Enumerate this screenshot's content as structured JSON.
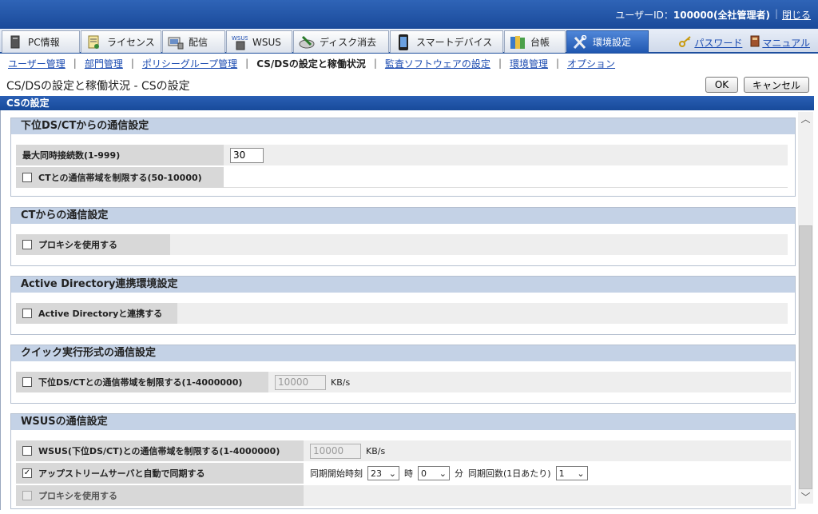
{
  "header": {
    "user_label": "ユーザーID：",
    "user_value": "100000(全社管理者)",
    "close": "閉じる"
  },
  "tabs": [
    {
      "label": "PC情報",
      "icon": "pc-icon"
    },
    {
      "label": "ライセンス",
      "icon": "license-icon"
    },
    {
      "label": "配信",
      "icon": "delivery-icon"
    },
    {
      "label": "WSUS",
      "icon": "wsus-icon",
      "icon_text": "WSUS"
    },
    {
      "label": "ディスク消去",
      "icon": "disk-erase-icon"
    },
    {
      "label": "スマートデバイス",
      "icon": "smartphone-icon"
    },
    {
      "label": "台帳",
      "icon": "ledger-icon"
    },
    {
      "label": "環境設定",
      "icon": "tools-icon"
    }
  ],
  "toplinks": {
    "password": "パスワード",
    "manual": "マニュアル"
  },
  "subnav": [
    "ユーザー管理",
    "部門管理",
    "ポリシーグループ管理",
    "CS/DSの設定と稼働状況",
    "監査ソフトウェアの設定",
    "環境管理",
    "オプション"
  ],
  "page": {
    "title": "CS/DSの設定と稼働状況 - CSの設定",
    "ok": "OK",
    "cancel": "キャンセル",
    "section": "CSの設定"
  },
  "groups": {
    "lower": {
      "title": "下位DS/CTからの通信設定",
      "max_conn_label": "最大同時接続数(1-999)",
      "max_conn_value": "30",
      "ct_bw_label": "CTとの通信帯域を制限する(50-10000)"
    },
    "ct": {
      "title": "CTからの通信設定",
      "proxy_label": "プロキシを使用する"
    },
    "ad": {
      "title": "Active Directory連携環境設定",
      "ad_label": "Active Directoryと連携する"
    },
    "quick": {
      "title": "クイック実行形式の通信設定",
      "bw_label": "下位DS/CTとの通信帯域を制限する(1-4000000)",
      "bw_value": "10000",
      "unit": "KB/s"
    },
    "wsus": {
      "title": "WSUSの通信設定",
      "bw_label": "WSUS(下位DS/CT)との通信帯域を制限する(1-4000000)",
      "bw_value": "10000",
      "unit": "KB/s",
      "sync_label": "アップストリームサーバと自動で同期する",
      "sync_start_label": "同期開始時刻",
      "hour_value": "23",
      "hour_unit": "時",
      "minute_value": "0",
      "minute_unit": "分",
      "count_label": "同期回数(1日あたり)",
      "count_value": "1",
      "proxy_label": "プロキシを使用する"
    }
  }
}
